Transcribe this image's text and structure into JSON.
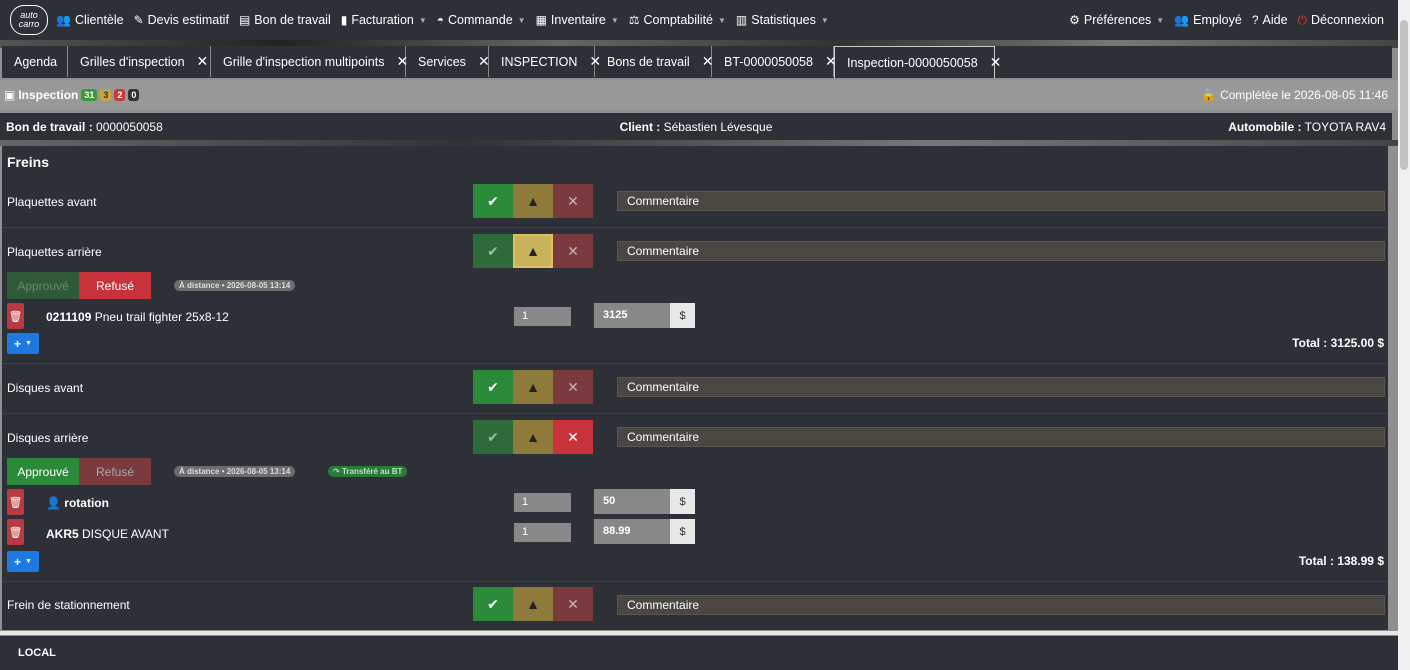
{
  "logo": {
    "line1": "auto",
    "line2": "carro"
  },
  "nav": {
    "items": [
      {
        "label": "Clientèle",
        "icon": "users-icon"
      },
      {
        "label": "Devis estimatif",
        "icon": "edit-icon"
      },
      {
        "label": "Bon de travail",
        "icon": "truck-icon"
      },
      {
        "label": "Facturation",
        "icon": "file-icon"
      },
      {
        "label": "Commande",
        "icon": "cart-icon"
      },
      {
        "label": "Inventaire",
        "icon": "grid-icon"
      },
      {
        "label": "Comptabilité",
        "icon": "scale-icon"
      },
      {
        "label": "Statistiques",
        "icon": "bar-chart-icon"
      }
    ],
    "right": {
      "preferences": "Préférences",
      "employee": "Employé",
      "help": "Aide",
      "logout": "Déconnexion"
    }
  },
  "tabs": [
    {
      "label": "Agenda",
      "closable": false
    },
    {
      "label": "Grilles d'inspection",
      "closable": true
    },
    {
      "label": "Grille d'inspection multipoints",
      "closable": true
    },
    {
      "label": "Services",
      "closable": true
    },
    {
      "label": "INSPECTION",
      "closable": true
    },
    {
      "label": "Bons de travail",
      "closable": true
    },
    {
      "label": "BT-0000050058",
      "closable": true
    },
    {
      "label": "Inspection-0000050058",
      "closable": true,
      "active": true
    }
  ],
  "inspection": {
    "title": "Inspection",
    "badges": {
      "green": "31",
      "yellow": "3",
      "red": "2",
      "dark": "0"
    },
    "completed": "Complétée le 2026-08-05 11:46"
  },
  "info": {
    "work_order_label": "Bon de travail :",
    "work_order_value": "0000050058",
    "client_label": "Client :",
    "client_value": "Sébastien Lévesque",
    "car_label": "Automobile :",
    "car_value": "TOYOTA RAV4"
  },
  "section": {
    "title": "Freins"
  },
  "rows": {
    "r1": {
      "label": "Plaquettes avant",
      "comment": "Commentaire"
    },
    "r2": {
      "label": "Plaquettes arrière",
      "comment": "Commentaire"
    },
    "r3": {
      "label": "Disques avant",
      "comment": "Commentaire"
    },
    "r4": {
      "label": "Disques arrière",
      "comment": "Commentaire"
    },
    "r5": {
      "label": "Frein de stationnement",
      "comment": "Commentaire"
    }
  },
  "decisions": {
    "approve": "Approuvé",
    "refuse": "Refusé",
    "remote1": "À distance • 2026-08-05 13:14",
    "remote2": "À distance • 2026-08-05 13:14",
    "transferred": "Transféré au BT"
  },
  "items": {
    "i1": {
      "code": "0211109",
      "name": "Pneu trail fighter 25x8-12",
      "qty": "1",
      "price": "3125",
      "currency": "$"
    },
    "i2": {
      "code": "",
      "name": "rotation",
      "qty": "1",
      "price": "50",
      "currency": "$"
    },
    "i3": {
      "code": "AKR5",
      "name": "DISQUE AVANT",
      "qty": "1",
      "price": "88.99",
      "currency": "$"
    }
  },
  "totals": {
    "t1": "Total : 3125.00 $",
    "t2": "Total : 138.99 $"
  },
  "footer": {
    "label": "LOCAL"
  },
  "colors": {
    "accent_blue": "#1e7ae0",
    "ok_green": "#2a8a3a",
    "warn_yellow": "#c9b25a",
    "ko_red": "#c8323a"
  }
}
